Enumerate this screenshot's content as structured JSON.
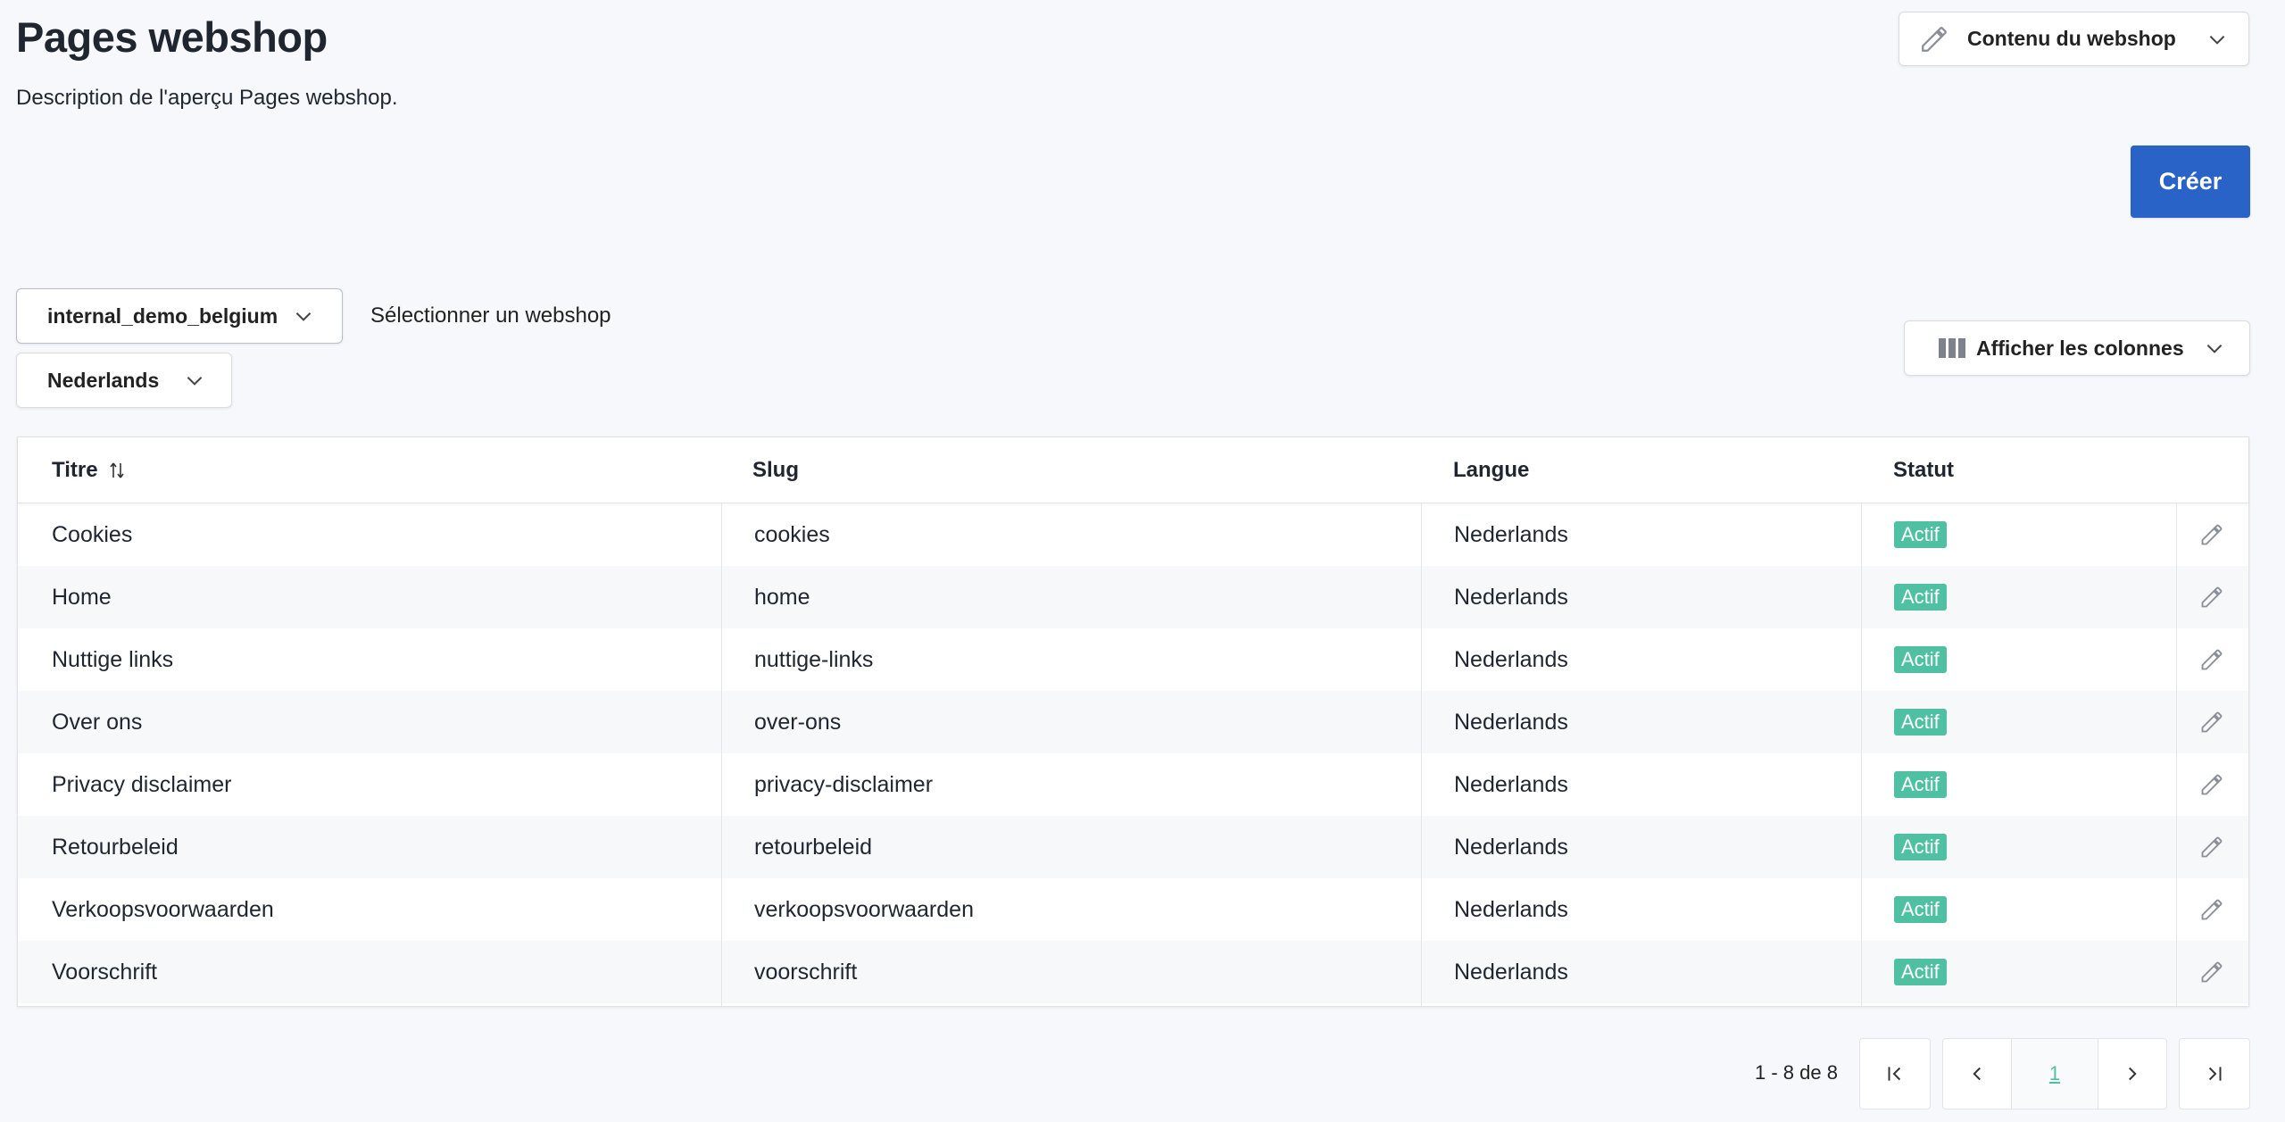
{
  "page": {
    "title": "Pages webshop",
    "description": "Description de l'aperçu Pages webshop."
  },
  "header_menu": {
    "label": "Contenu du webshop",
    "icon": "pencil-icon"
  },
  "create_button": {
    "label": "Créer"
  },
  "filters": {
    "webshop": "internal_demo_belgium",
    "webshop_hint": "Sélectionner un webshop",
    "language": "Nederlands"
  },
  "columns_menu": {
    "label": "Afficher les colonnes",
    "icon": "columns-icon"
  },
  "table": {
    "headers": {
      "title": "Titre",
      "slug": "Slug",
      "language": "Langue",
      "status": "Statut"
    },
    "sort_icon": "sort-icon",
    "rows": [
      {
        "title": "Cookies",
        "slug": "cookies",
        "language": "Nederlands",
        "status": "Actif"
      },
      {
        "title": "Home",
        "slug": "home",
        "language": "Nederlands",
        "status": "Actif"
      },
      {
        "title": "Nuttige links",
        "slug": "nuttige-links",
        "language": "Nederlands",
        "status": "Actif"
      },
      {
        "title": "Over ons",
        "slug": "over-ons",
        "language": "Nederlands",
        "status": "Actif"
      },
      {
        "title": "Privacy disclaimer",
        "slug": "privacy-disclaimer",
        "language": "Nederlands",
        "status": "Actif"
      },
      {
        "title": "Retourbeleid",
        "slug": "retourbeleid",
        "language": "Nederlands",
        "status": "Actif"
      },
      {
        "title": "Verkoopsvoorwaarden",
        "slug": "verkoopsvoorwaarden",
        "language": "Nederlands",
        "status": "Actif"
      },
      {
        "title": "Voorschrift",
        "slug": "voorschrift",
        "language": "Nederlands",
        "status": "Actif"
      }
    ]
  },
  "pagination": {
    "range": "1 - 8 de 8",
    "current_page": "1"
  },
  "colors": {
    "accent": "#2a63c7",
    "status_active": "#4fc1a2"
  }
}
